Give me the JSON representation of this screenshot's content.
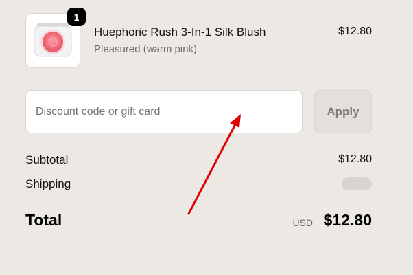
{
  "cart": {
    "item": {
      "name": "Huephoric Rush 3-In-1 Silk Blush",
      "variant": "Pleasured (warm pink)",
      "price": "$12.80",
      "quantity": "1",
      "image_icon": "blush-compact-icon"
    }
  },
  "discount": {
    "placeholder": "Discount code or gift card",
    "value": "",
    "apply_label": "Apply"
  },
  "summary": {
    "subtotal_label": "Subtotal",
    "subtotal_value": "$12.80",
    "shipping_label": "Shipping",
    "total_label": "Total",
    "total_currency": "USD",
    "total_value": "$12.80"
  },
  "colors": {
    "background": "#ece8e4",
    "annotation_arrow": "#e00000",
    "badge": "#000000",
    "blush": "#f27a83"
  }
}
